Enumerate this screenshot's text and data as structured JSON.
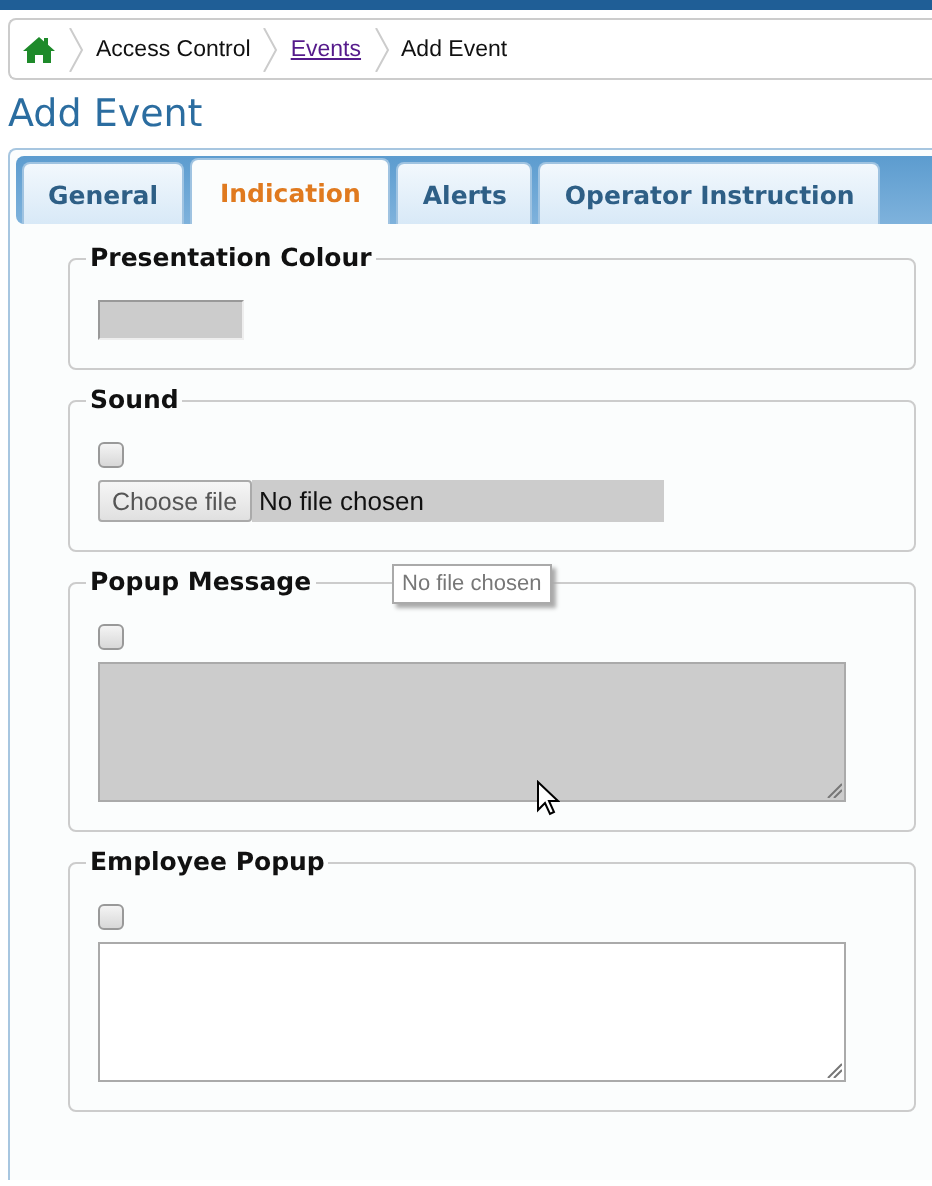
{
  "breadcrumb": [
    {
      "kind": "home"
    },
    {
      "kind": "text",
      "label": "Access Control"
    },
    {
      "kind": "link",
      "label": "Events"
    },
    {
      "kind": "text",
      "label": "Add Event"
    }
  ],
  "page_title": "Add Event",
  "tabs": [
    {
      "label": "General",
      "selected": false
    },
    {
      "label": "Indication",
      "selected": true
    },
    {
      "label": "Alerts",
      "selected": false
    },
    {
      "label": "Operator Instruction",
      "selected": false
    }
  ],
  "sections": [
    {
      "legend": "Presentation Colour",
      "kind": "colour",
      "disabled": true
    },
    {
      "legend": "Sound",
      "kind": "file",
      "checked": false,
      "button": "Choose file",
      "value": "No file chosen",
      "disabled": true,
      "tooltip": "No file chosen"
    },
    {
      "legend": "Popup Message",
      "kind": "textarea",
      "checked": false,
      "disabled": true
    },
    {
      "legend": "Employee Popup",
      "kind": "textarea",
      "checked": false,
      "disabled": false
    }
  ]
}
